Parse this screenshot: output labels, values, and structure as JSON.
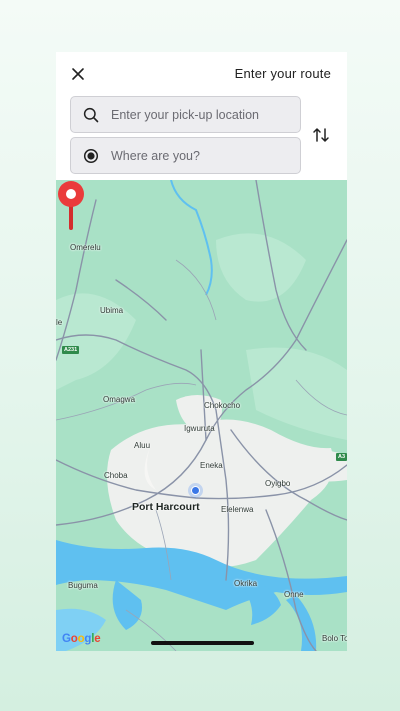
{
  "header": {
    "title": "Enter your route",
    "close_icon": "close-icon",
    "swap_icon": "swap-vertical-icon"
  },
  "pickup": {
    "placeholder": "Enter your pick-up location",
    "value": "",
    "icon": "search-icon"
  },
  "destination": {
    "placeholder": "Where are you?",
    "value": "",
    "icon": "radio-target-icon"
  },
  "map": {
    "labels": {
      "omerelu": "Omerelu",
      "ubima": "Ubima",
      "le": "le",
      "omagwa": "Omagwa",
      "chokocho": "Chokocho",
      "igwuruta": "Igwuruta",
      "aluu": "Aluu",
      "eneka": "Eneka",
      "choba": "Choba",
      "oyigbo": "Oyigbo",
      "port_harcourt": "Port Harcourt",
      "elelenwa": "Elelenwa",
      "buguma": "Buguma",
      "okrika": "Okrika",
      "onne": "Onne",
      "bolo": "Bolo To"
    },
    "road_shields": {
      "a231": "A231",
      "a3": "A3"
    },
    "attribution": [
      "G",
      "o",
      "o",
      "g",
      "l",
      "e"
    ],
    "colors": {
      "land": "#a9e1c6",
      "water": "#5fc0f0",
      "urban": "#eef0ee",
      "pin": "#ea3b3b",
      "location": "#3b78e7"
    }
  }
}
